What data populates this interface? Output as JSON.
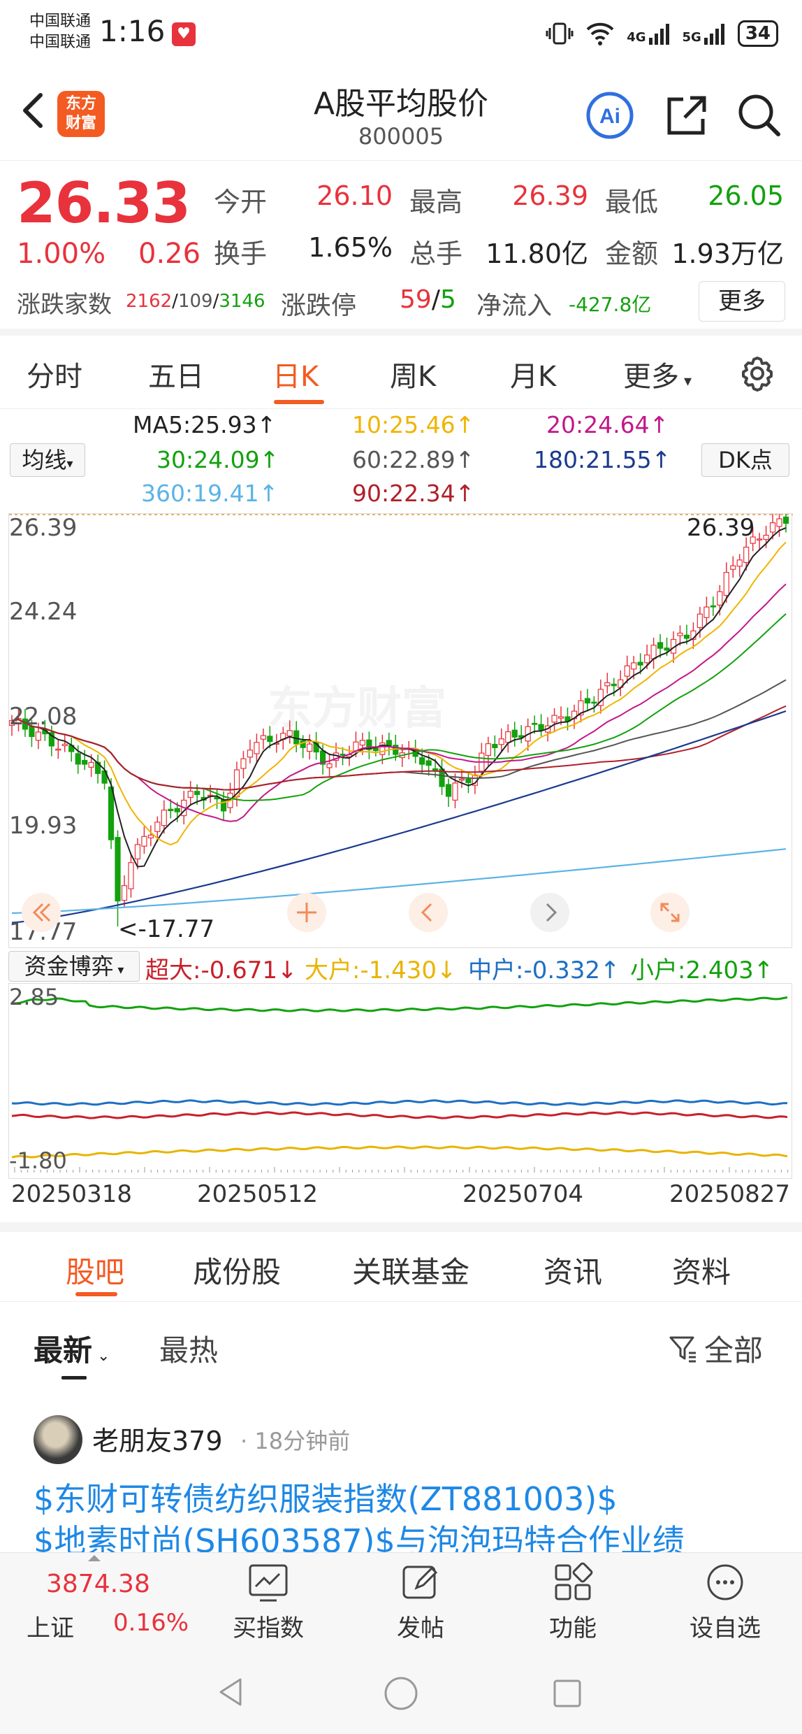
{
  "status_bar": {
    "carrier_1": "中国联通",
    "carrier_2": "中国联通",
    "time": "1:16",
    "network_4g": "4G",
    "network_5g": "5G",
    "battery": "34"
  },
  "header": {
    "logo_text_1": "东方",
    "logo_text_2": "财富",
    "title": "A股平均股价",
    "code": "800005"
  },
  "quote": {
    "price": "26.33",
    "change_pct": "1.00%",
    "change_val": "0.26",
    "rows": [
      {
        "l1": "今开",
        "v1": "26.10",
        "l2": "最高",
        "v2": "26.39",
        "l3": "最低",
        "v3": "26.05"
      },
      {
        "l1": "换手",
        "v1": "1.65%",
        "l2": "总手",
        "v2": "11.80亿",
        "l3": "金额",
        "v3": "1.93万亿"
      }
    ],
    "breadth_label": "涨跌家数",
    "breadth_up": "2162",
    "breadth_sep1": "/",
    "breadth_flat": "109",
    "breadth_sep2": "/",
    "breadth_down": "3146",
    "limit_label": "涨跌停",
    "limit_up": "59",
    "limit_sep": "/",
    "limit_down": "5",
    "netflow_label": "净流入",
    "netflow_value": "-427.8亿",
    "more_label": "更多"
  },
  "ktabs": [
    "分时",
    "五日",
    "日K",
    "周K",
    "月K",
    "更多"
  ],
  "ma": {
    "selector": "均线",
    "dk": "DK点",
    "items": [
      {
        "text": "MA5:25.93↑",
        "color": "#222222"
      },
      {
        "text": "10:25.46↑",
        "color": "#f0b400"
      },
      {
        "text": "20:24.64↑",
        "color": "#c2188a"
      },
      {
        "text": "30:24.09↑",
        "color": "#13a10e"
      },
      {
        "text": "60:22.89↑",
        "color": "#555555"
      },
      {
        "text": "180:21.55↑",
        "color": "#1a3a8f"
      },
      {
        "text": "360:19.41↑",
        "color": "#5bb3e6"
      },
      {
        "text": "90:22.34↑",
        "color": "#b0202a"
      }
    ]
  },
  "chart": {
    "y_ticks": [
      "26.39",
      "24.24",
      "22.08",
      "19.93",
      "17.77"
    ],
    "high_label": "26.39",
    "low_label": "<-17.77",
    "watermark": "东方财富",
    "x_dates": [
      "20250318",
      "20250512",
      "20250704",
      "20250827"
    ]
  },
  "capital_flow": {
    "selector": "资金博弈",
    "items": [
      {
        "text": "超大:-0.671↓",
        "color": "#c8202a"
      },
      {
        "text": "大户:-1.430↓",
        "color": "#e8b400"
      },
      {
        "text": "中户:-0.332↑",
        "color": "#1e6fc2"
      },
      {
        "text": "小户:2.403↑",
        "color": "#13a10e"
      }
    ],
    "y_top": "2.85",
    "y_bottom": "-1.80"
  },
  "bottom_tabs": [
    "股吧",
    "成份股",
    "关联基金",
    "资讯",
    "资料"
  ],
  "sort": {
    "latest": "最新",
    "hot": "最热",
    "filter": "全部"
  },
  "post": {
    "author": "老朋友379",
    "time": "· 18分钟前",
    "line1": "$东财可转债纺织服装指数(ZT881003)$",
    "line2": "$地素时尚(SH603587)$与泡泡玛特合作业绩"
  },
  "bottom_nav": {
    "index_name": "上证",
    "index_value": "3874.38",
    "index_change": "0.16%",
    "items": [
      "买指数",
      "发帖",
      "功能",
      "设自选"
    ]
  }
}
